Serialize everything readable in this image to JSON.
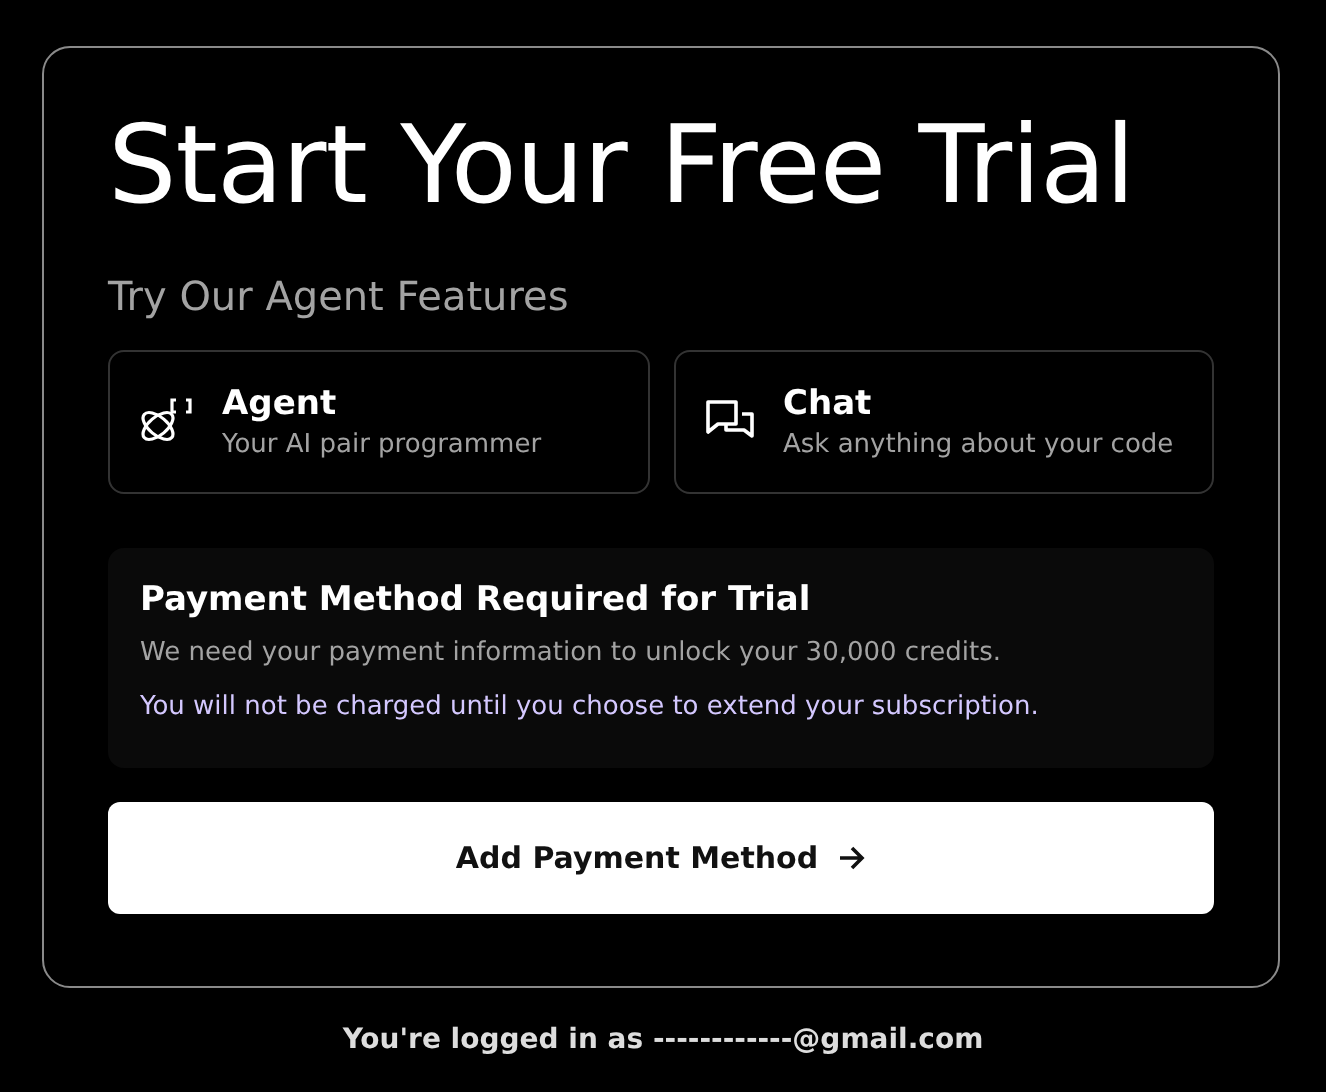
{
  "title": "Start Your Free Trial",
  "subtitle": "Try Our Agent Features",
  "features": [
    {
      "kind": "agent",
      "name": "Agent",
      "description": "Your AI pair programmer"
    },
    {
      "kind": "chat",
      "name": "Chat",
      "description": "Ask anything about your code"
    }
  ],
  "notice": {
    "heading": "Payment Method Required for Trial",
    "body": "We need your payment information to unlock your 30,000 credits.",
    "note": "You will not be charged until you choose to extend your subscription."
  },
  "button": {
    "label": "Add Payment Method"
  },
  "footer": "You're logged in as ------------@gmail.com"
}
